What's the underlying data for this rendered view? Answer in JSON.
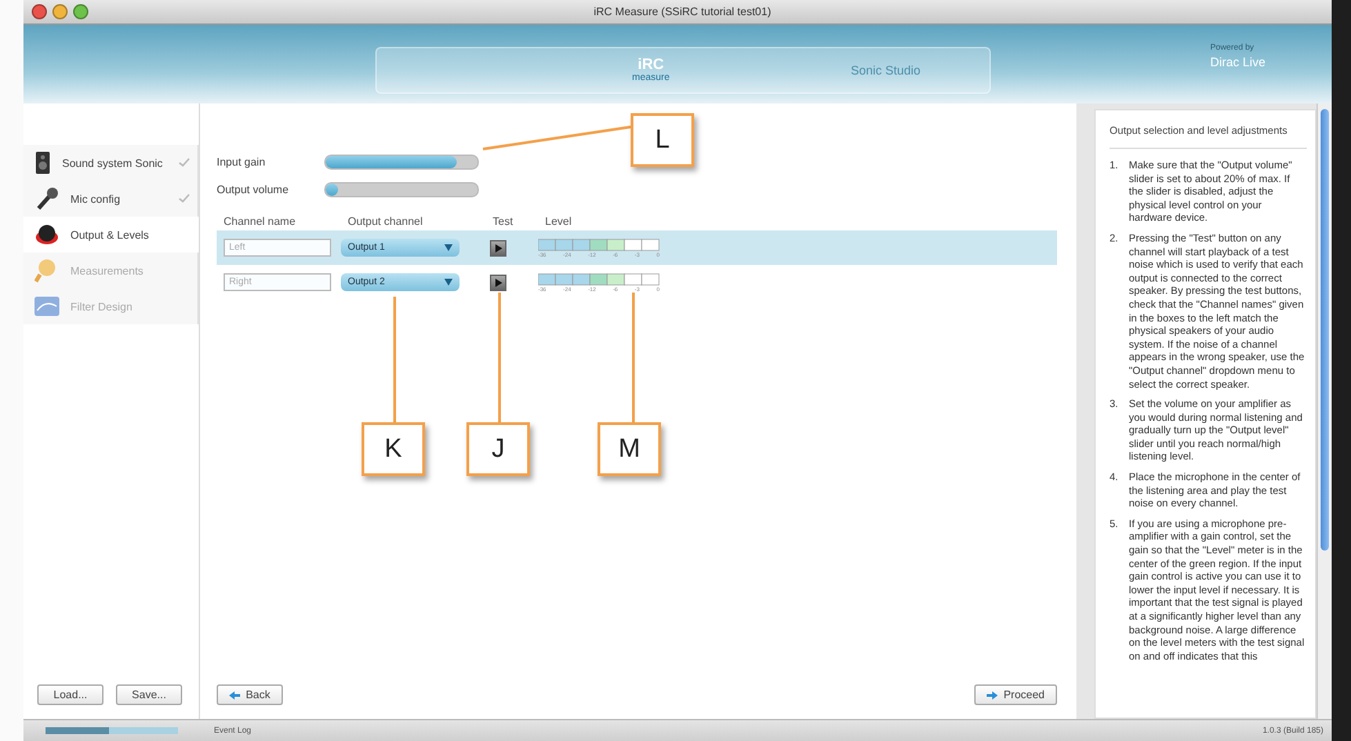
{
  "window": {
    "title": "iRC Measure (SSiRC tutorial test01)"
  },
  "header": {
    "logo_name": "iRC",
    "logo_sub": "measure",
    "product": "Sonic Studio",
    "powered_by": "Powered by",
    "partner": "Dirac Live"
  },
  "sidebar": {
    "items": [
      {
        "label": "Sound system Sonic",
        "kind": "speaker",
        "done": true,
        "disabled": false,
        "selected": false
      },
      {
        "label": "Mic config",
        "kind": "mic",
        "done": true,
        "disabled": false,
        "selected": false
      },
      {
        "label": "Output & Levels",
        "kind": "output",
        "done": false,
        "disabled": false,
        "selected": true
      },
      {
        "label": "Measurements",
        "kind": "measure",
        "done": false,
        "disabled": true,
        "selected": false
      },
      {
        "label": "Filter Design",
        "kind": "filter",
        "done": false,
        "disabled": true,
        "selected": false
      }
    ],
    "buttons": [
      "Load...",
      "Save..."
    ]
  },
  "sliders": [
    {
      "label": "Input gain",
      "level": 0.86
    },
    {
      "label": "Output volume",
      "level": 0.03
    }
  ],
  "channels": {
    "columns": [
      "Channel name",
      "Output channel",
      "Test",
      "Level"
    ],
    "rows": [
      {
        "placeholder": "Left",
        "output": "Output 1",
        "selected": true,
        "ticks": [
          "-36",
          "-24",
          "-12",
          "-6",
          "-3",
          "0"
        ]
      },
      {
        "placeholder": "Right",
        "output": "Output 2",
        "selected": false,
        "ticks": [
          "-36",
          "-24",
          "-12",
          "-6",
          "-3",
          "0"
        ]
      }
    ]
  },
  "nav": {
    "back": "Back",
    "proceed": "Proceed"
  },
  "help": {
    "title": "Output selection and level adjustments",
    "steps": [
      {
        "number": "1.",
        "text": "Make sure that the \"Output volume\" slider is set to about 20% of max. If the slider is disabled, adjust the physical level control on your hardware device."
      },
      {
        "number": "2.",
        "text": "Pressing the \"Test\" button on any channel will start playback of a test noise which is used to verify that each output is connected to the correct speaker. By pressing the test buttons, check that the \"Channel names\" given in the boxes to the left match the physical speakers of your audio system. If the noise of a channel appears in the wrong speaker, use the \"Output channel\" dropdown menu to select the correct speaker."
      },
      {
        "number": "3.",
        "text": "Set the volume on your amplifier as you would during normal listening and gradually turn up the \"Output level\" slider until you reach normal/high listening level."
      },
      {
        "number": "4.",
        "text": "Place the microphone in the center of the listening area and play the test noise on every channel."
      },
      {
        "number": "5.",
        "text": "If you are using a microphone pre-amplifier with a gain control, set the gain so that the \"Level\" meter is in the center of the green region. If the input gain control is active you can use it to lower the input level if necessary. It is important that the test signal is played at a significantly higher level than any background noise. A large difference on the level meters with the test signal on and off indicates that this"
      }
    ]
  },
  "status_bar": {
    "progress": {
      "level": 0.48
    },
    "log": "Event Log",
    "version": "1.0.3 (Build 185)"
  },
  "callouts": [
    {
      "label": "L"
    },
    {
      "label": "K"
    },
    {
      "label": "J"
    },
    {
      "label": "M"
    }
  ]
}
